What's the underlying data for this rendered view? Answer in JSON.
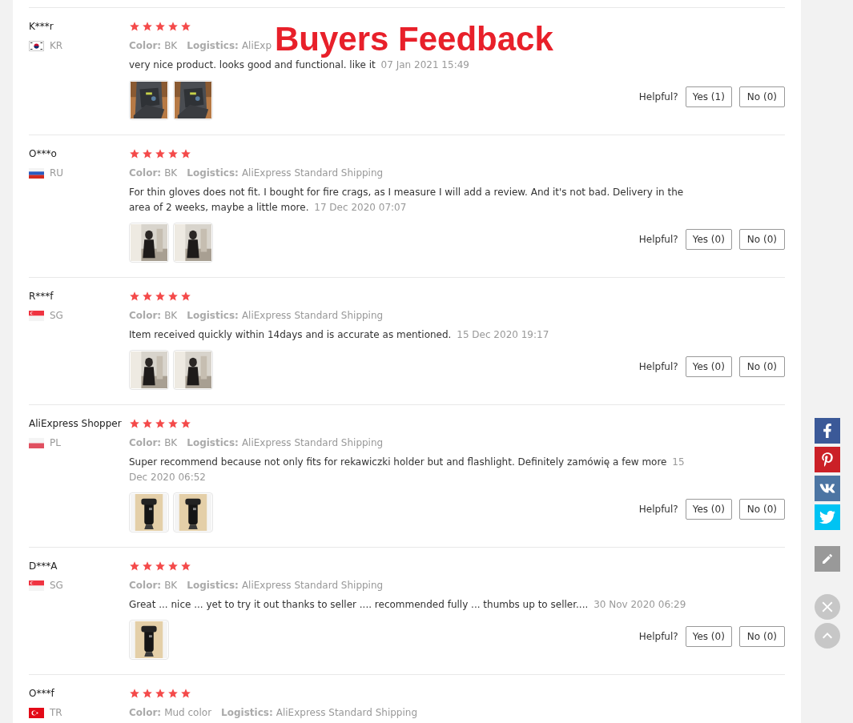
{
  "banner_title": "Buyers Feedback",
  "reviews": [
    {
      "name": "K***r",
      "flag": {
        "kind": "kr"
      },
      "country": "KR",
      "stars": 5,
      "color_label": "Color:",
      "color_value": "BK",
      "logistics_label": "Logistics:",
      "logistics_value": "AliExp",
      "text": "very nice product. looks good and functional. like it",
      "date": "07 Jan 2021 15:49",
      "photos": [
        {
          "kind": "picture"
        },
        {
          "kind": "picture"
        }
      ],
      "helpful_label": "Helpful?",
      "yes": "Yes (1)",
      "no": "No (0)"
    },
    {
      "name": "O***o",
      "flag": {
        "kind": "ru"
      },
      "country": "RU",
      "stars": 5,
      "color_label": "Color:",
      "color_value": "BK",
      "logistics_label": "Logistics:",
      "logistics_value": "AliExpress Standard Shipping",
      "text": "For thin gloves does not fit. I bought for fire crags, as I measure I will add a review. And it's not bad. Delivery in the area of 2 weeks, maybe a little more.",
      "date": "17 Dec 2020 07:07",
      "photos": [
        {
          "kind": "picture"
        },
        {
          "kind": "picture"
        }
      ],
      "helpful_label": "Helpful?",
      "yes": "Yes (0)",
      "no": "No (0)"
    },
    {
      "name": "R***f",
      "flag": {
        "kind": "sg"
      },
      "country": "SG",
      "stars": 5,
      "color_label": "Color:",
      "color_value": "BK",
      "logistics_label": "Logistics:",
      "logistics_value": "AliExpress Standard Shipping",
      "text": "Item received quickly within 14days and is accurate as mentioned.",
      "date": "15 Dec 2020 19:17",
      "photos": [
        {
          "kind": "picture"
        },
        {
          "kind": "picture"
        }
      ],
      "helpful_label": "Helpful?",
      "yes": "Yes (0)",
      "no": "No (0)"
    },
    {
      "name": "AliExpress Shopper",
      "flag": {
        "kind": "pl"
      },
      "country": "PL",
      "stars": 5,
      "color_label": "Color:",
      "color_value": "BK",
      "logistics_label": "Logistics:",
      "logistics_value": "AliExpress Standard Shipping",
      "text": "Super recommend because not only fits for rekawiczki holder but and flashlight. Definitely zamówię a few more",
      "date": "15 Dec 2020 06:52",
      "photos": [
        {
          "kind": "picture"
        },
        {
          "kind": "picture"
        }
      ],
      "helpful_label": "Helpful?",
      "yes": "Yes (0)",
      "no": "No (0)"
    },
    {
      "name": "D***A",
      "flag": {
        "kind": "sg"
      },
      "country": "SG",
      "stars": 5,
      "color_label": "Color:",
      "color_value": "BK",
      "logistics_label": "Logistics:",
      "logistics_value": "AliExpress Standard Shipping",
      "text": "Great ... nice ... yet to try it out thanks to seller .... recommended fully ... thumbs up to seller....",
      "date": "30 Nov 2020 06:29",
      "photos": [
        {
          "kind": "picture"
        }
      ],
      "helpful_label": "Helpful?",
      "yes": "Yes (0)",
      "no": "No (0)"
    },
    {
      "name": "O***f",
      "flag": {
        "kind": "tr"
      },
      "country": "TR",
      "stars": 5,
      "color_label": "Color:",
      "color_value": "Mud color",
      "logistics_label": "Logistics:",
      "logistics_value": "AliExpress Standard Shipping"
    }
  ],
  "side_buttons": [
    {
      "kind": "facebook"
    },
    {
      "kind": "pinterest"
    },
    {
      "kind": "vk"
    },
    {
      "kind": "twitter"
    },
    {
      "kind": "edit"
    },
    {
      "kind": "close"
    },
    {
      "kind": "top"
    }
  ]
}
